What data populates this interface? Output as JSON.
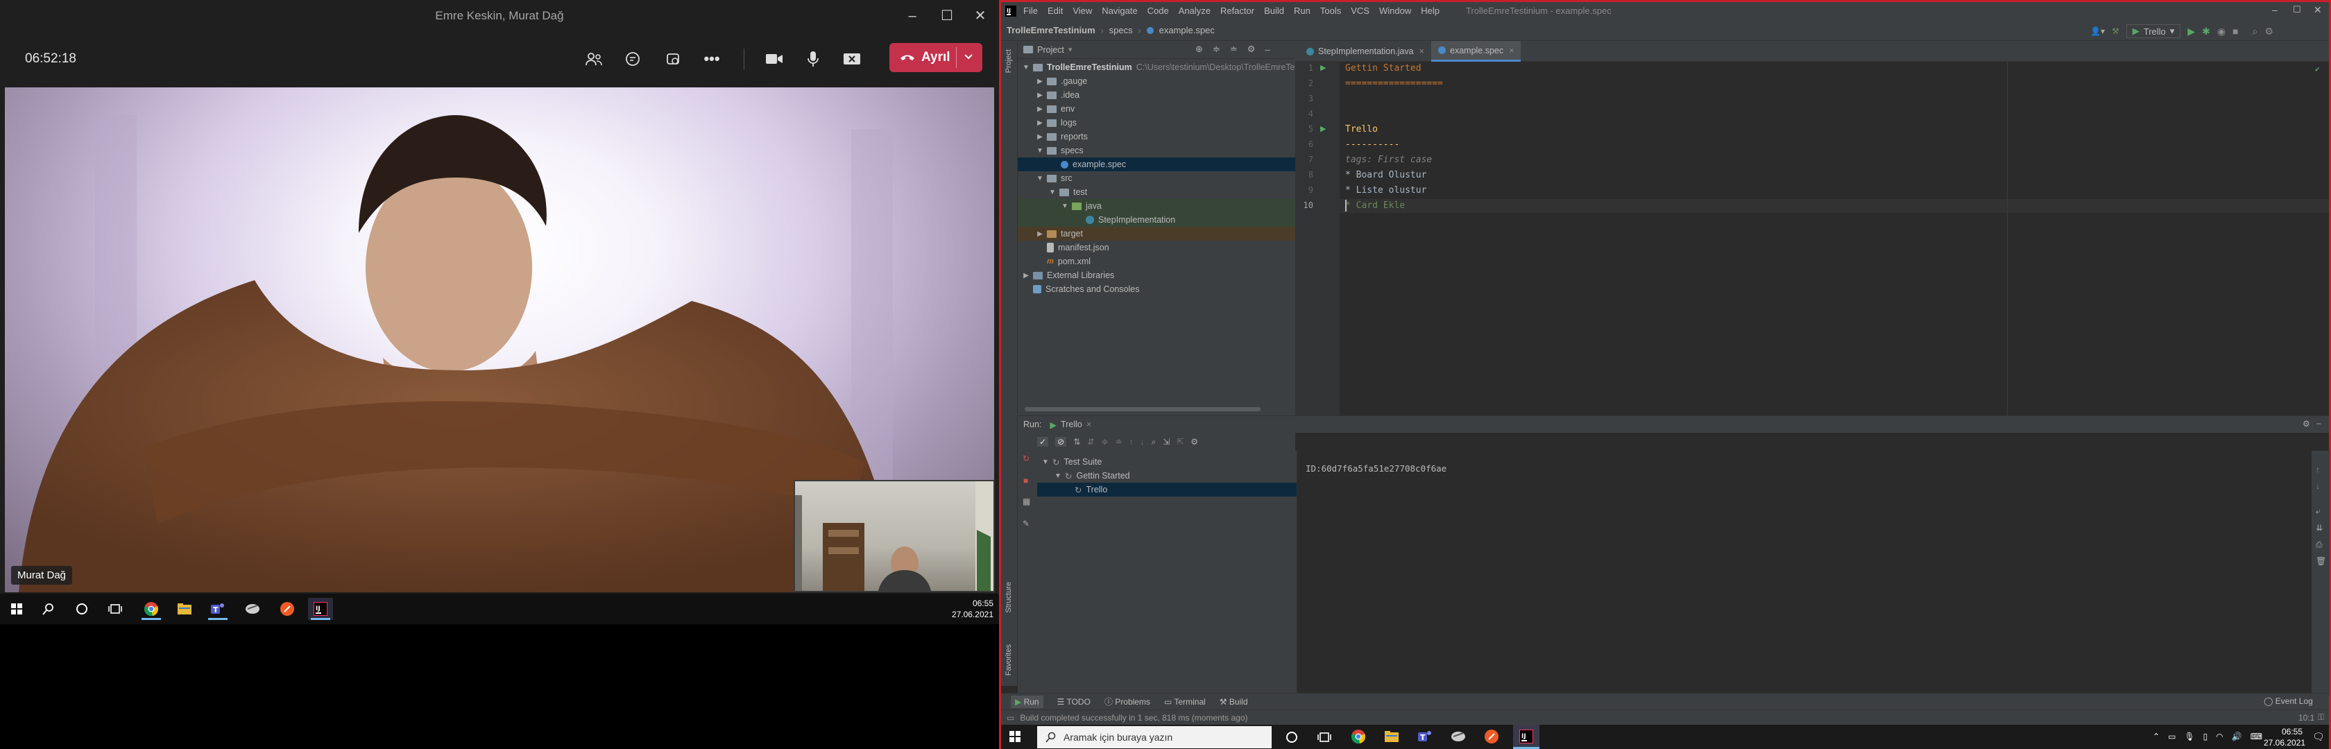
{
  "teams": {
    "window_title": "Emre Keskin, Murat Dağ",
    "timer": "06:52:18",
    "leave_label": "Ayrıl",
    "speaker_name": "Murat Dağ",
    "clock_time": "06:55",
    "clock_date": "27.06.2021"
  },
  "ide": {
    "window_title": "TrolleEmreTestinium - example.spec",
    "menu": [
      "File",
      "Edit",
      "View",
      "Navigate",
      "Code",
      "Analyze",
      "Refactor",
      "Build",
      "Run",
      "Tools",
      "VCS",
      "Window",
      "Help"
    ],
    "breadcrumb": [
      "TrolleEmreTestinium",
      "specs",
      "example.spec"
    ],
    "run_config": "Trello",
    "project_label": "Project",
    "project_root": "TrolleEmreTestinium",
    "project_path": "C:\\Users\\testinium\\Desktop\\TrolleEmreTe",
    "tree": [
      ".gauge",
      ".idea",
      "env",
      "logs",
      "reports",
      "specs",
      "example.spec",
      "src",
      "test",
      "java",
      "StepImplementation",
      "target",
      "manifest.json",
      "pom.xml",
      "External Libraries",
      "Scratches and Consoles"
    ],
    "tabs": [
      "StepImplementation.java",
      "example.spec"
    ],
    "code_lines": [
      {
        "n": "1",
        "text": "Gettin Started"
      },
      {
        "n": "2",
        "text": "=================="
      },
      {
        "n": "3",
        "text": ""
      },
      {
        "n": "4",
        "text": ""
      },
      {
        "n": "5",
        "text": "Trello"
      },
      {
        "n": "6",
        "text": "----------"
      },
      {
        "n": "7",
        "text": "tags: First case"
      },
      {
        "n": "8",
        "text": "* Board Olustur"
      },
      {
        "n": "9",
        "text": "* Liste olustur"
      },
      {
        "n": "10",
        "text": "* Card Ekle"
      }
    ],
    "run_label": "Run:",
    "run_tab": "Trello",
    "run_tree": [
      "Test Suite",
      "Gettin Started",
      "Trello"
    ],
    "console_output": "ID:60d7f6a5fa51e27708c0f6ae",
    "bottom_tabs": [
      "Run",
      "TODO",
      "Problems",
      "Terminal",
      "Build"
    ],
    "event_log": "Event Log",
    "status_message": "Build completed successfully in 1 sec, 818 ms (moments ago)",
    "cursor_pos": "10:1",
    "left_stripe": [
      "Project",
      "Structure",
      "Favorites"
    ]
  },
  "taskbar": {
    "search_placeholder": "Aramak için buraya yazın",
    "clock_time": "06:55",
    "clock_date": "27.06.2021"
  },
  "colors": {
    "teams_leave": "#c4314b",
    "ide_frame": "#c8202a",
    "ide_bg": "#2b2b2b",
    "keyword": "#cc7832",
    "string": "#6a8759",
    "comment": "#808080"
  }
}
